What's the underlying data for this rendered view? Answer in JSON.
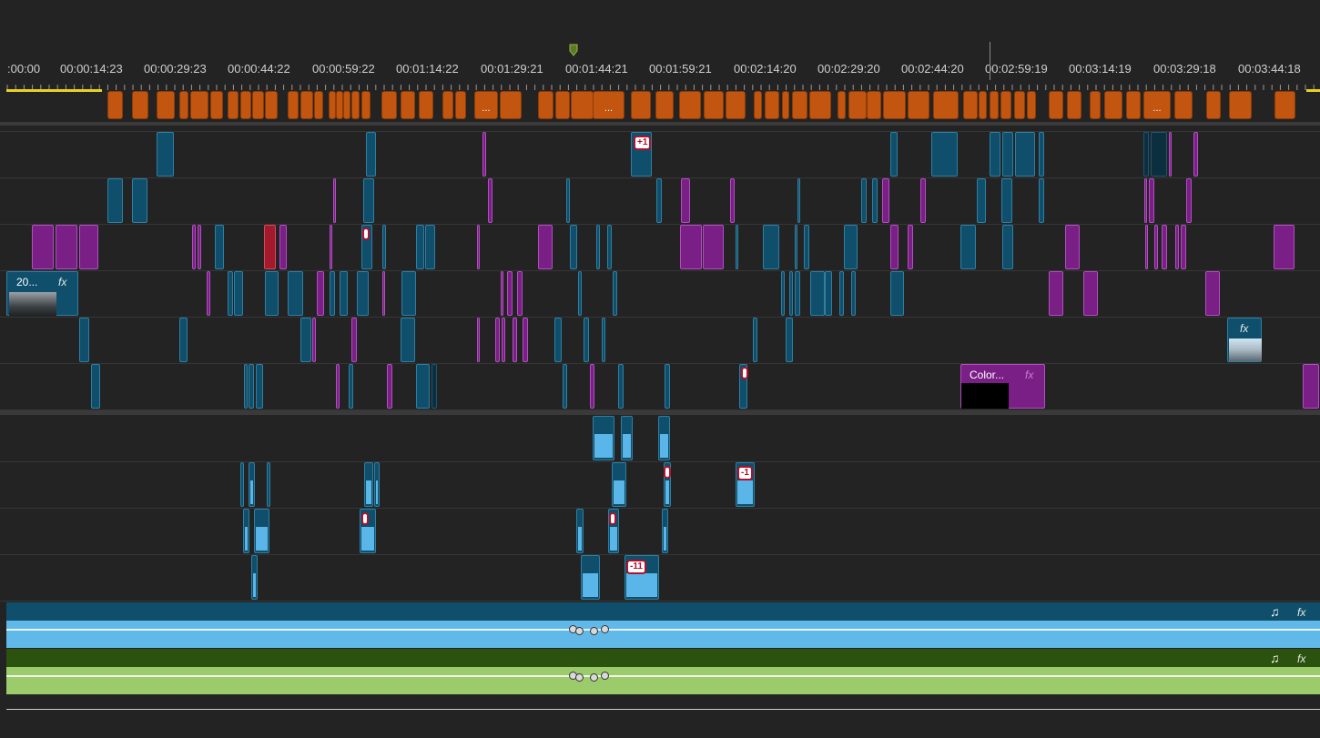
{
  "timeline": {
    "timecodes": [
      ":00:00",
      "00:00:14:23",
      "00:00:29:23",
      "00:00:44:22",
      "00:00:59:22",
      "00:01:14:22",
      "00:01:29:21",
      "00:01:44:21",
      "00:01:59:21",
      "00:02:14:20",
      "00:02:29:20",
      "00:02:44:20",
      "00:02:59:19",
      "00:03:14:19",
      "00:03:29:18",
      "00:03:44:18"
    ],
    "marker_overflow_label": "...",
    "clips": {
      "v3_first_clip_label": "20...",
      "color_matte_label": "Color...",
      "fx_label": "fx"
    },
    "badges": [
      "+1",
      "-1",
      "-11"
    ],
    "audio_icon": "♫",
    "colors": {
      "background": "#232323",
      "marker": "#c2550f",
      "video_clip_blue": "#0f4f6b",
      "video_clip_purple": "#7a1f86",
      "audio_a1": "#0f4f6b",
      "audio_a2": "#2b520f",
      "in_out_bar": "#e8d21c",
      "playhead": "#5a7a24"
    },
    "icons": [
      "playhead-icon",
      "fx-icon",
      "music-note-icon",
      "keyframe-icon"
    ]
  }
}
